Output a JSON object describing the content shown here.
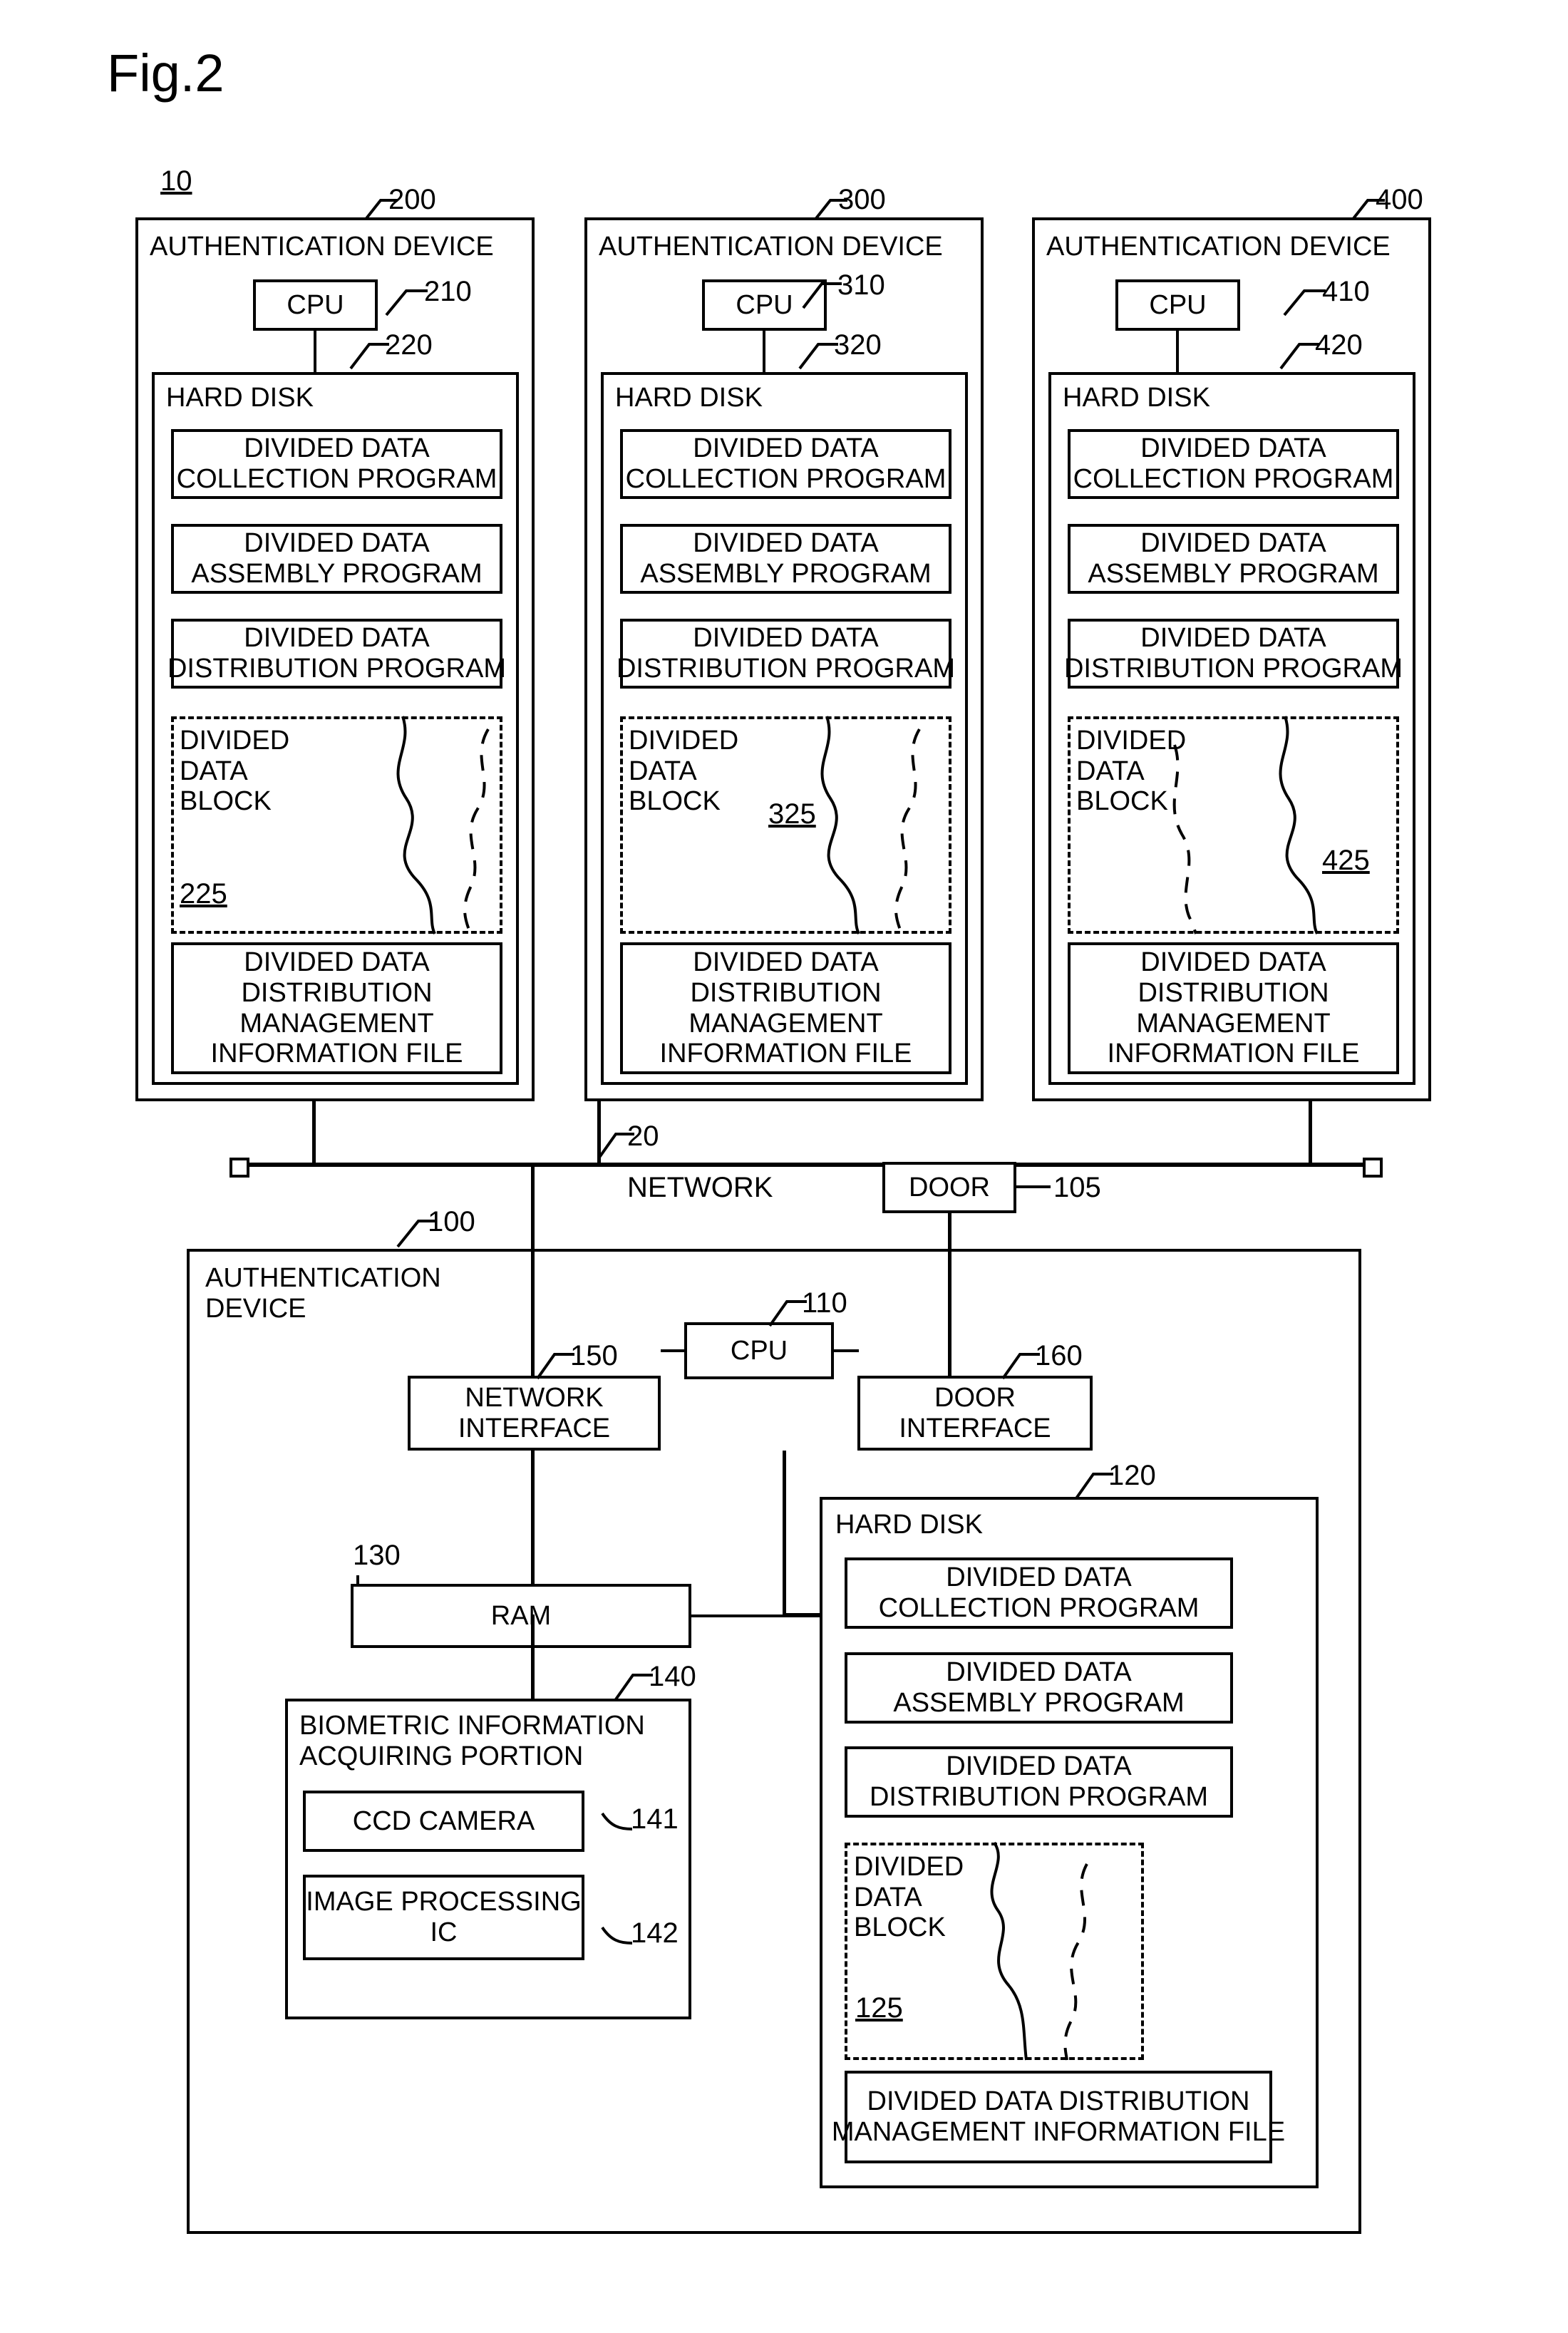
{
  "figure": {
    "title": "Fig.2",
    "system_ref": "10"
  },
  "network": {
    "label": "NETWORK",
    "ref": "20",
    "door_label": "DOOR",
    "door_ref": "105"
  },
  "top_devices": [
    {
      "title": "AUTHENTICATION DEVICE",
      "ref": "200",
      "cpu_label": "CPU",
      "cpu_ref": "210",
      "hdd_label": "HARD DISK",
      "hdd_ref": "220",
      "programs": [
        "DIVIDED DATA\nCOLLECTION PROGRAM",
        "DIVIDED DATA\nASSEMBLY PROGRAM",
        "DIVIDED DATA\nDISTRIBUTION PROGRAM"
      ],
      "block_label": "DIVIDED\nDATA\nBLOCK",
      "block_ref": "225",
      "info_file": "DIVIDED DATA\nDISTRIBUTION\nMANAGEMENT\nINFORMATION FILE"
    },
    {
      "title": "AUTHENTICATION DEVICE",
      "ref": "300",
      "cpu_label": "CPU",
      "cpu_ref": "310",
      "hdd_label": "HARD DISK",
      "hdd_ref": "320",
      "programs": [
        "DIVIDED DATA\nCOLLECTION PROGRAM",
        "DIVIDED DATA\nASSEMBLY PROGRAM",
        "DIVIDED DATA\nDISTRIBUTION PROGRAM"
      ],
      "block_label": "DIVIDED\nDATA\nBLOCK",
      "block_ref": "325",
      "info_file": "DIVIDED DATA\nDISTRIBUTION\nMANAGEMENT\nINFORMATION FILE"
    },
    {
      "title": "AUTHENTICATION DEVICE",
      "ref": "400",
      "cpu_label": "CPU",
      "cpu_ref": "410",
      "hdd_label": "HARD DISK",
      "hdd_ref": "420",
      "programs": [
        "DIVIDED DATA\nCOLLECTION PROGRAM",
        "DIVIDED DATA\nASSEMBLY PROGRAM",
        "DIVIDED DATA\nDISTRIBUTION PROGRAM"
      ],
      "block_label": "DIVIDED\nDATA\nBLOCK",
      "block_ref": "425",
      "info_file": "DIVIDED DATA\nDISTRIBUTION\nMANAGEMENT\nINFORMATION FILE"
    }
  ],
  "main_device": {
    "title": "AUTHENTICATION\nDEVICE",
    "ref": "100",
    "cpu_label": "CPU",
    "cpu_ref": "110",
    "network_interface": "NETWORK\nINTERFACE",
    "network_interface_ref": "150",
    "door_interface": "DOOR\nINTERFACE",
    "door_interface_ref": "160",
    "ram_label": "RAM",
    "ram_ref": "130",
    "biometric_label": "BIOMETRIC INFORMATION\nACQUIRING PORTION",
    "biometric_ref": "140",
    "ccd_label": "CCD CAMERA",
    "ccd_ref": "141",
    "image_proc_label": "IMAGE PROCESSING\nIC",
    "image_proc_ref": "142",
    "hdd_label": "HARD DISK",
    "hdd_ref": "120",
    "programs": [
      "DIVIDED DATA\nCOLLECTION PROGRAM",
      "DIVIDED DATA\nASSEMBLY PROGRAM",
      "DIVIDED DATA\nDISTRIBUTION PROGRAM"
    ],
    "block_label": "DIVIDED\nDATA\nBLOCK",
    "block_ref": "125",
    "info_file": "DIVIDED DATA DISTRIBUTION\nMANAGEMENT INFORMATION FILE"
  }
}
